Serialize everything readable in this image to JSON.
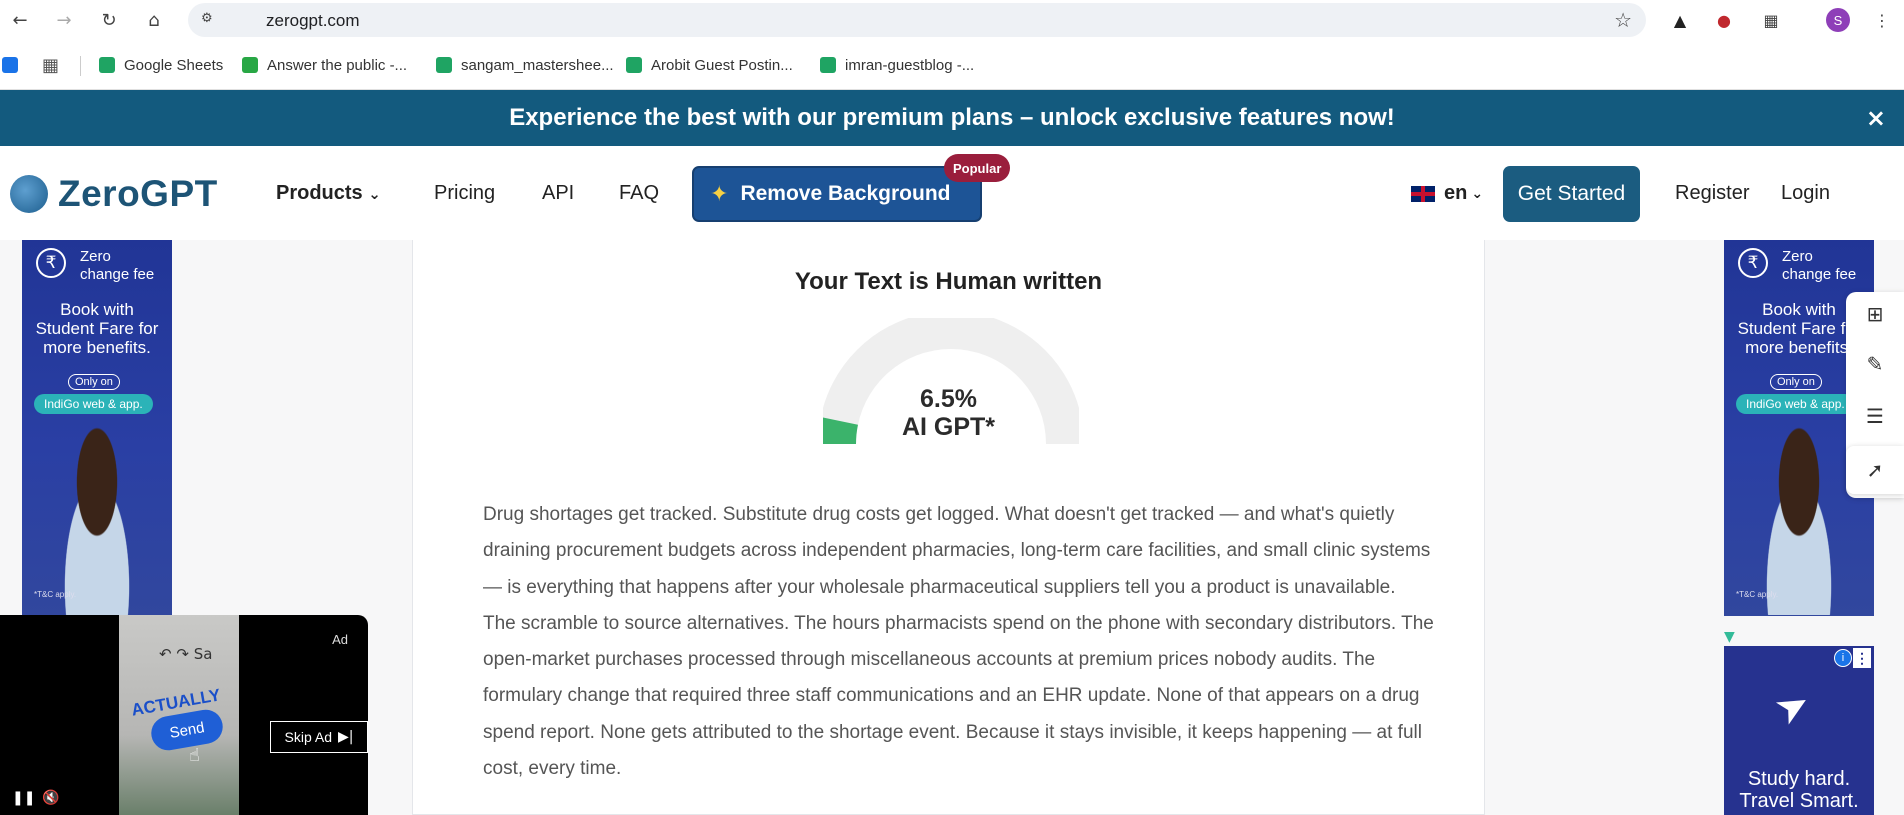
{
  "browser": {
    "url": "zerogpt.com",
    "avatar_initial": "S",
    "bookmarks": [
      "Google Sheets",
      "Answer the public -...",
      "sangam_mastershee...",
      "Arobit Guest Postin...",
      "imran-guestblog -..."
    ]
  },
  "promo": {
    "text": "Experience the best with our premium plans – unlock exclusive features now!",
    "close": "×"
  },
  "header": {
    "logo": "ZeroGPT",
    "nav": {
      "products": "Products",
      "pricing": "Pricing",
      "api": "API",
      "faq": "FAQ"
    },
    "remove_bg": "Remove Background",
    "popular": "Popular",
    "lang": "en",
    "get_started": "Get Started",
    "register": "Register",
    "login": "Login"
  },
  "ad_left": {
    "fee": "Zero change fee",
    "book": "Book with Student Fare for more benefits.",
    "only": "Only on",
    "cta": "IndiGo web & app.",
    "tnc": "*T&C apply."
  },
  "ad_study": {
    "text": "Study hard. Travel Smart."
  },
  "result": {
    "title": "Your Text is Human written",
    "percent_text": "6.5%",
    "percent_value": 6.5,
    "label": "AI GPT*",
    "gauge_color": "#3bb36b",
    "paragraph1": "Drug shortages get tracked. Substitute drug costs get logged. What doesn't get tracked — and what's quietly draining procurement budgets across independent pharmacies, long-term care facilities, and small clinic systems — is everything that happens after your wholesale pharmaceutical suppliers tell you a product is unavailable.",
    "paragraph2": "The scramble to source alternatives. The hours pharmacists spend on the phone with secondary distributors. The open-market purchases processed through miscellaneous accounts at premium prices nobody audits. The formulary change that required three staff communications and an EHR update. None of that appears on a drug spend report. None gets attributed to the shortage event. Because it stays invisible, it keeps happening — at full cost, every time."
  },
  "video_ad": {
    "ad_label": "Ad",
    "phone_text": "Sa",
    "actually": "ACTUALLY",
    "send": "Send",
    "skip": "Skip Ad"
  },
  "colors": {
    "brand": "#1d5476",
    "promo_bg": "#135a7e",
    "button_blue": "#1d5496",
    "badge": "#9a1e3c"
  }
}
